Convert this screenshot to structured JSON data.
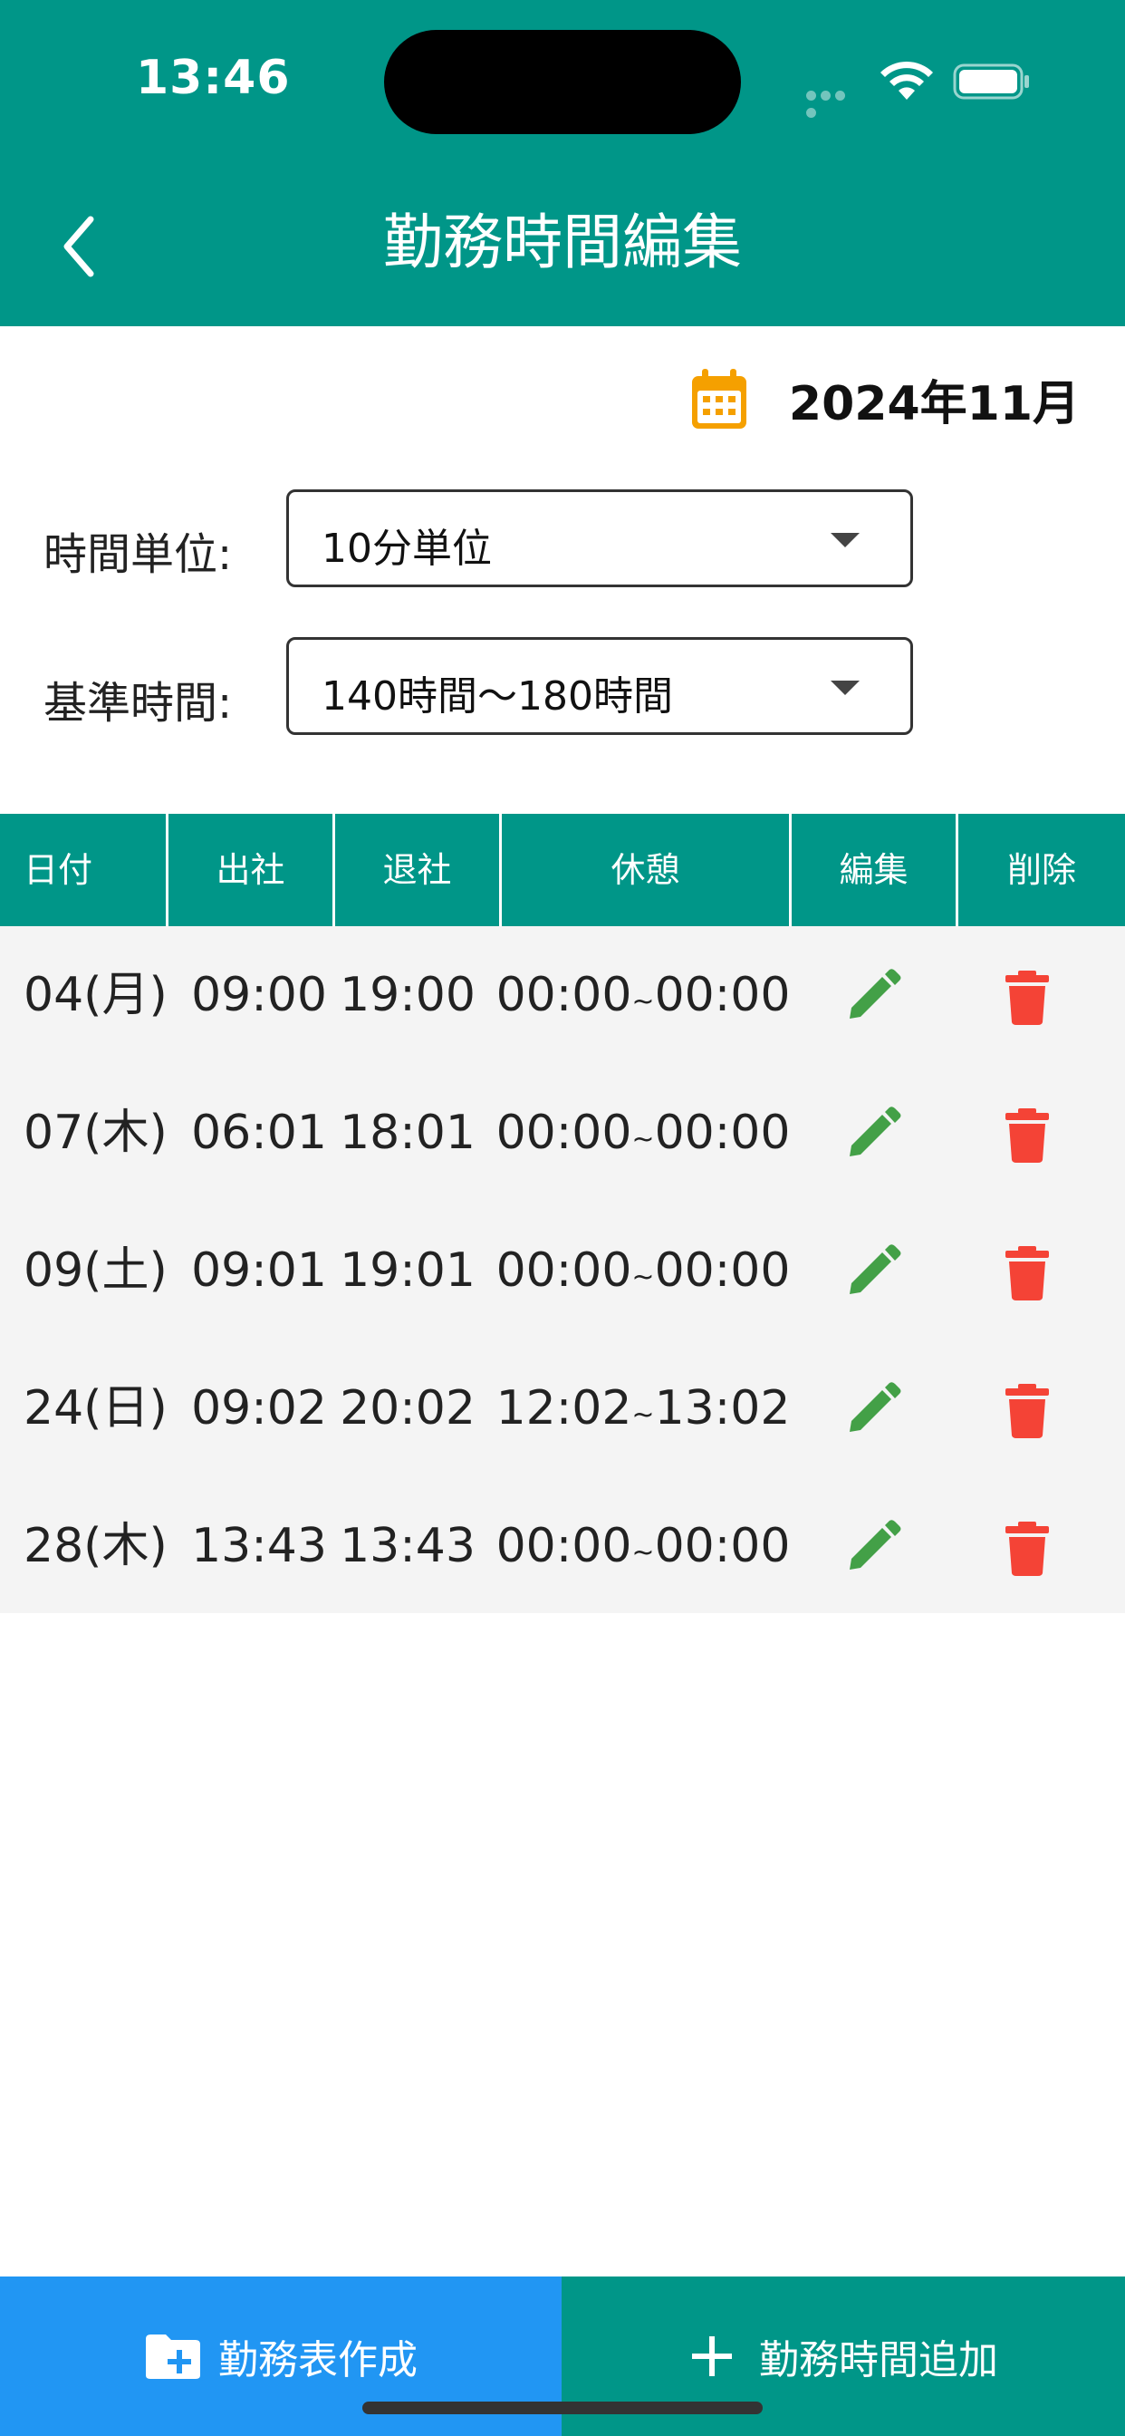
{
  "status_bar": {
    "time": "13:46"
  },
  "header": {
    "title": "勤務時間編集"
  },
  "month": {
    "label": "2024年11月"
  },
  "settings": {
    "time_unit": {
      "label": "時間単位:",
      "value": "10分単位"
    },
    "base_hours": {
      "label": "基準時間:",
      "value": "140時間〜180時間"
    }
  },
  "table": {
    "columns": [
      "日付",
      "出社",
      "退社",
      "休憩",
      "編集",
      "削除"
    ],
    "rows": [
      {
        "date": "04(月)",
        "in": "09:00",
        "out": "19:00",
        "break_start": "00:00",
        "break_end": "00:00"
      },
      {
        "date": "07(木)",
        "in": "06:01",
        "out": "18:01",
        "break_start": "00:00",
        "break_end": "00:00"
      },
      {
        "date": "09(土)",
        "in": "09:01",
        "out": "19:01",
        "break_start": "00:00",
        "break_end": "00:00"
      },
      {
        "date": "24(日)",
        "in": "09:02",
        "out": "20:02",
        "break_start": "12:02",
        "break_end": "13:02"
      },
      {
        "date": "28(木)",
        "in": "13:43",
        "out": "13:43",
        "break_start": "00:00",
        "break_end": "00:00"
      }
    ],
    "tilde": "~"
  },
  "footer": {
    "create_sheet_label": "勤務表作成",
    "add_time_label": "勤務時間追加"
  },
  "colors": {
    "primary": "#009688",
    "blue": "#2196f3",
    "edit_green": "#43a047",
    "delete_red": "#f44336",
    "calendar_orange": "#f5a000"
  },
  "icons": [
    "back-chevron-icon",
    "calendar-icon",
    "edit-pencil-icon",
    "trash-icon",
    "folder-add-icon",
    "plus-icon"
  ]
}
